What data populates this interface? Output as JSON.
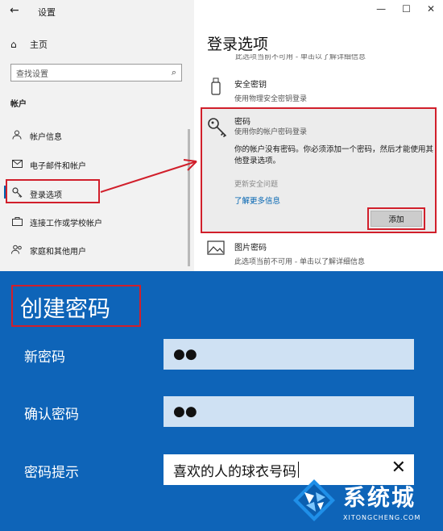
{
  "window": {
    "back_glyph": "←",
    "title": "设置",
    "min_glyph": "—",
    "max_glyph": "☐",
    "close_glyph": "✕"
  },
  "sidebar": {
    "home_label": "主页",
    "search_placeholder": "查找设置",
    "section_title": "帐户",
    "items": [
      {
        "label": "帐户信息",
        "icon": "person-icon"
      },
      {
        "label": "电子邮件和帐户",
        "icon": "mail-icon"
      },
      {
        "label": "登录选项",
        "icon": "key-icon"
      },
      {
        "label": "连接工作或学校帐户",
        "icon": "briefcase-icon"
      },
      {
        "label": "家庭和其他用户",
        "icon": "people-icon"
      }
    ]
  },
  "main": {
    "page_title": "登录选项",
    "cut_desc": "此选项当前不可用 - 单击以了解详细信息",
    "security_key": {
      "title": "安全密钥",
      "desc": "使用物理安全密钥登录"
    },
    "password": {
      "title": "密码",
      "desc": "使用你的帐户密码登录",
      "message": "你的帐户没有密码。你必须添加一个密码，然后才能使用其他登录选项。",
      "update_label": "更新安全问题",
      "learn_more": "了解更多信息",
      "add_button": "添加"
    },
    "picture_password": {
      "title": "图片密码",
      "desc": "此选项当前不可用 - 单击以了解详细信息"
    }
  },
  "create_password": {
    "title": "创建密码",
    "new_label": "新密码",
    "new_value": "●●",
    "confirm_label": "确认密码",
    "confirm_value": "●●",
    "hint_label": "密码提示",
    "hint_value": "喜欢的人的球衣号码",
    "clear_glyph": "✕"
  },
  "watermark": {
    "cn": "系统城",
    "en": "XITONGCHENG.COM"
  },
  "colors": {
    "accent": "#0063b1",
    "highlight": "#d11f2b",
    "dialog_bg": "#0e64b8"
  }
}
